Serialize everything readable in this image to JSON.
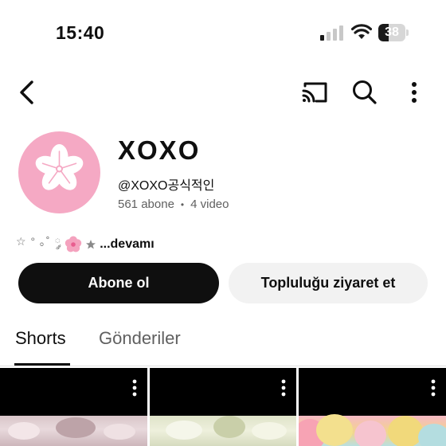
{
  "status_bar": {
    "time": "15:40",
    "battery": "38",
    "battery_level": 0.38
  },
  "top_bar": {
    "icons": [
      "back-arrow-icon",
      "cast-icon",
      "search-icon",
      "more-vertical-icon"
    ]
  },
  "channel": {
    "name": "XOXO",
    "handle": "@XOXO공식적인",
    "subscribers": "561 abone",
    "separator": "•",
    "videos": "4 video",
    "description_prefix": "☆ ° ｡˚ ༘",
    "description_more": "...devamı",
    "avatar_color": "#f5a9c4"
  },
  "buttons": {
    "subscribe": "Abone ol",
    "community": "Topluluğu ziyaret et"
  },
  "tabs": [
    {
      "label": "Shorts",
      "active": true
    },
    {
      "label": "Gönderiler",
      "active": false
    }
  ],
  "colors": {
    "primary": "#0f0f0f",
    "secondary_text": "#606060",
    "chip_bg": "#f2f2f2"
  }
}
